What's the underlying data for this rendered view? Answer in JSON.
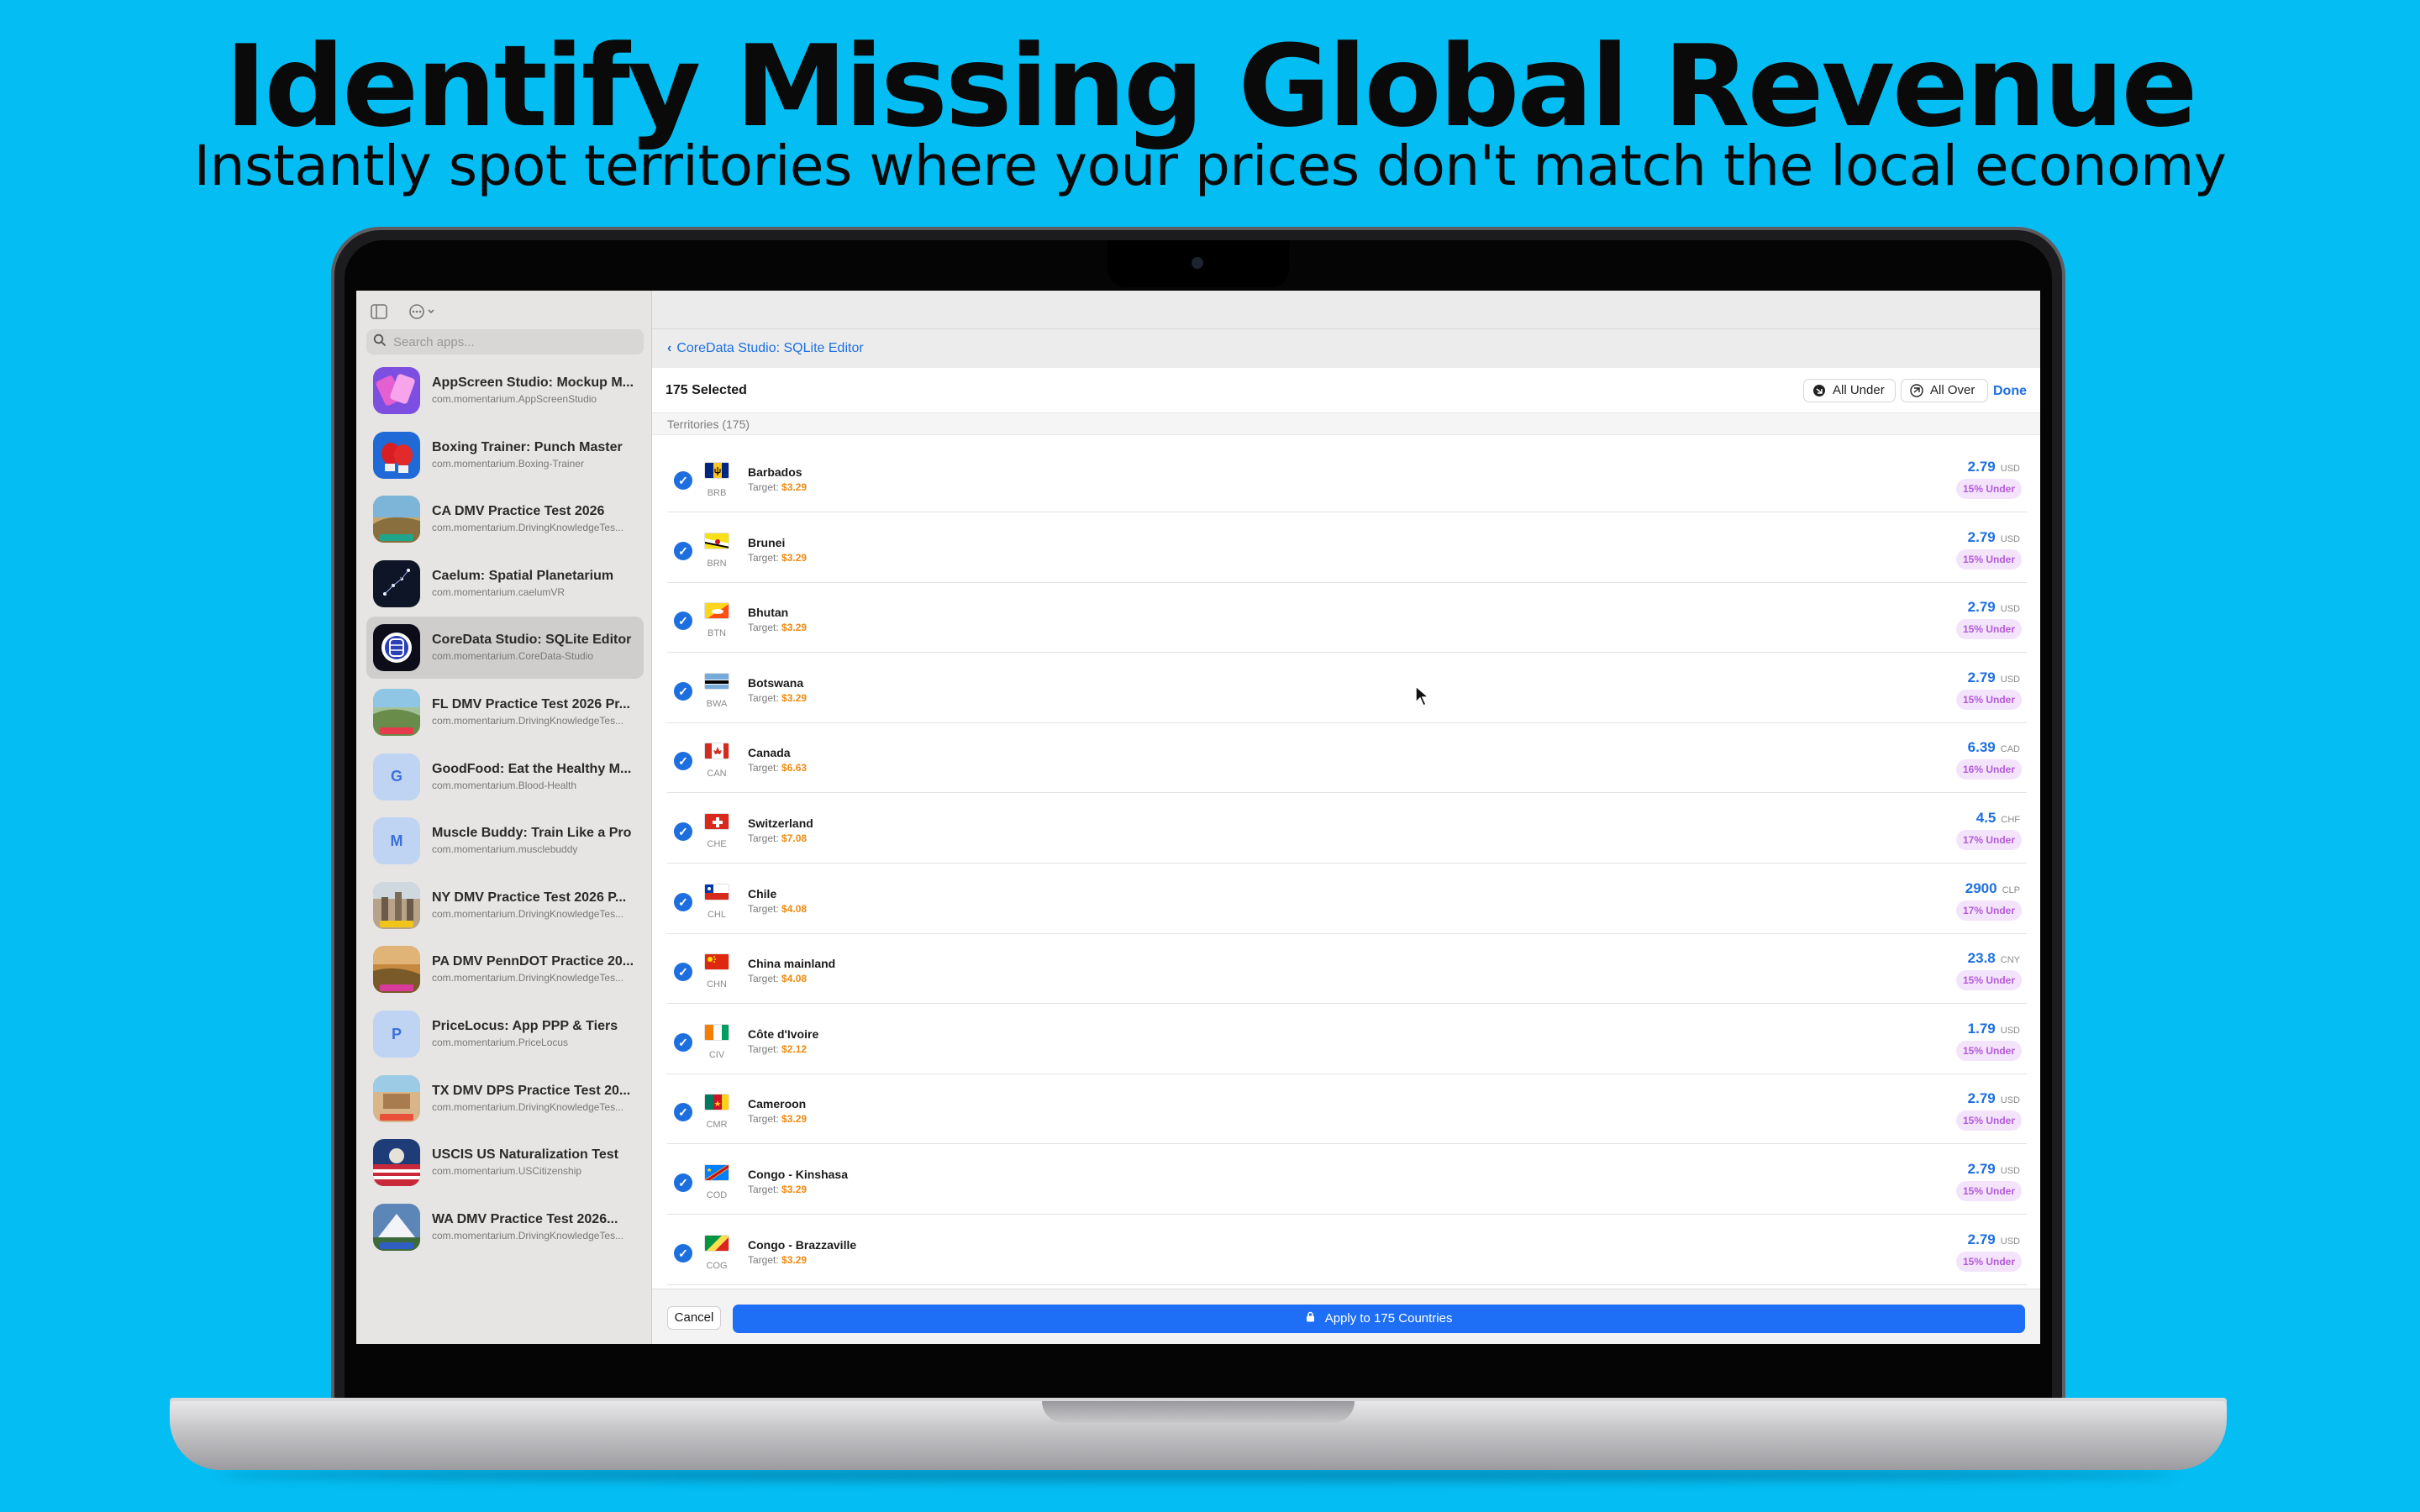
{
  "promo": {
    "headline": "Identify Missing Global Revenue",
    "subheadline": "Instantly spot territories where your prices don't match the local economy"
  },
  "sidebar": {
    "search_placeholder": "Search apps...",
    "apps": [
      {
        "name": "AppScreen Studio: Mockup M...",
        "bundle": "com.momentarium.AppScreenStudio",
        "icon": "appscreen-icon"
      },
      {
        "name": "Boxing Trainer: Punch Master",
        "bundle": "com.momentarium.Boxing-Trainer",
        "icon": "boxing-glove-icon"
      },
      {
        "name": "CA DMV Practice Test 2026",
        "bundle": "com.momentarium.DrivingKnowledgeTes...",
        "icon": "ca-dmv-icon"
      },
      {
        "name": "Caelum: Spatial Planetarium",
        "bundle": "com.momentarium.caelumVR",
        "icon": "planetarium-icon"
      },
      {
        "name": "CoreData Studio: SQLite Editor",
        "bundle": "com.momentarium.CoreData-Studio",
        "icon": "database-icon",
        "selected": true
      },
      {
        "name": "FL DMV Practice Test 2026 Pr...",
        "bundle": "com.momentarium.DrivingKnowledgeTes...",
        "icon": "fl-dmv-icon"
      },
      {
        "name": "GoodFood: Eat the Healthy M...",
        "bundle": "com.momentarium.Blood-Health",
        "icon": "letter-g-icon",
        "letter": "G"
      },
      {
        "name": "Muscle Buddy: Train Like a Pro",
        "bundle": "com.momentarium.musclebuddy",
        "icon": "letter-m-icon",
        "letter": "M"
      },
      {
        "name": "NY DMV Practice Test 2026 P...",
        "bundle": "com.momentarium.DrivingKnowledgeTes...",
        "icon": "ny-dmv-icon"
      },
      {
        "name": "PA DMV PennDOT Practice 20...",
        "bundle": "com.momentarium.DrivingKnowledgeTes...",
        "icon": "pa-dmv-icon"
      },
      {
        "name": "PriceLocus: App PPP & Tiers",
        "bundle": "com.momentarium.PriceLocus",
        "icon": "letter-p-icon",
        "letter": "P"
      },
      {
        "name": "TX DMV DPS Practice Test 20...",
        "bundle": "com.momentarium.DrivingKnowledgeTes...",
        "icon": "tx-dmv-icon"
      },
      {
        "name": "USCIS US Naturalization Test",
        "bundle": "com.momentarium.USCitizenship",
        "icon": "uscis-icon"
      },
      {
        "name": "WA DMV Practice Test 2026...",
        "bundle": "com.momentarium.DrivingKnowledgeTes...",
        "icon": "wa-dmv-icon"
      }
    ]
  },
  "main": {
    "back_label": "CoreData Studio: SQLite Editor",
    "selected_count": "175 Selected",
    "all_under": "All Under",
    "all_over": "All Over",
    "done": "Done",
    "section_title": "Territories (175)",
    "target_prefix": "Target:",
    "territories": [
      {
        "name": "Barbados",
        "code": "BRB",
        "target": "$3.29",
        "price": "2.79",
        "currency": "USD",
        "badge": "15% Under",
        "flag": "barbados-flag"
      },
      {
        "name": "Brunei",
        "code": "BRN",
        "target": "$3.29",
        "price": "2.79",
        "currency": "USD",
        "badge": "15% Under",
        "flag": "brunei-flag"
      },
      {
        "name": "Bhutan",
        "code": "BTN",
        "target": "$3.29",
        "price": "2.79",
        "currency": "USD",
        "badge": "15% Under",
        "flag": "bhutan-flag"
      },
      {
        "name": "Botswana",
        "code": "BWA",
        "target": "$3.29",
        "price": "2.79",
        "currency": "USD",
        "badge": "15% Under",
        "flag": "botswana-flag"
      },
      {
        "name": "Canada",
        "code": "CAN",
        "target": "$6.63",
        "price": "6.39",
        "currency": "CAD",
        "badge": "16% Under",
        "flag": "canada-flag"
      },
      {
        "name": "Switzerland",
        "code": "CHE",
        "target": "$7.08",
        "price": "4.5",
        "currency": "CHF",
        "badge": "17% Under",
        "flag": "switzerland-flag"
      },
      {
        "name": "Chile",
        "code": "CHL",
        "target": "$4.08",
        "price": "2900",
        "currency": "CLP",
        "badge": "17% Under",
        "flag": "chile-flag"
      },
      {
        "name": "China mainland",
        "code": "CHN",
        "target": "$4.08",
        "price": "23.8",
        "currency": "CNY",
        "badge": "15% Under",
        "flag": "china-flag"
      },
      {
        "name": "Côte d'Ivoire",
        "code": "CIV",
        "target": "$2.12",
        "price": "1.79",
        "currency": "USD",
        "badge": "15% Under",
        "flag": "cote-divoire-flag"
      },
      {
        "name": "Cameroon",
        "code": "CMR",
        "target": "$3.29",
        "price": "2.79",
        "currency": "USD",
        "badge": "15% Under",
        "flag": "cameroon-flag"
      },
      {
        "name": "Congo - Kinshasa",
        "code": "COD",
        "target": "$3.29",
        "price": "2.79",
        "currency": "USD",
        "badge": "15% Under",
        "flag": "congo-kinshasa-flag"
      },
      {
        "name": "Congo - Brazzaville",
        "code": "COG",
        "target": "$3.29",
        "price": "2.79",
        "currency": "USD",
        "badge": "15% Under",
        "flag": "congo-brazzaville-flag"
      }
    ],
    "cancel": "Cancel",
    "apply": "Apply to 175 Countries"
  },
  "colors": {
    "background": "#04bdf2",
    "accent": "#1d6fe0",
    "target_amount": "#ee8a10",
    "badge_text": "#b45ad9",
    "badge_bg": "#f3e4fb"
  }
}
